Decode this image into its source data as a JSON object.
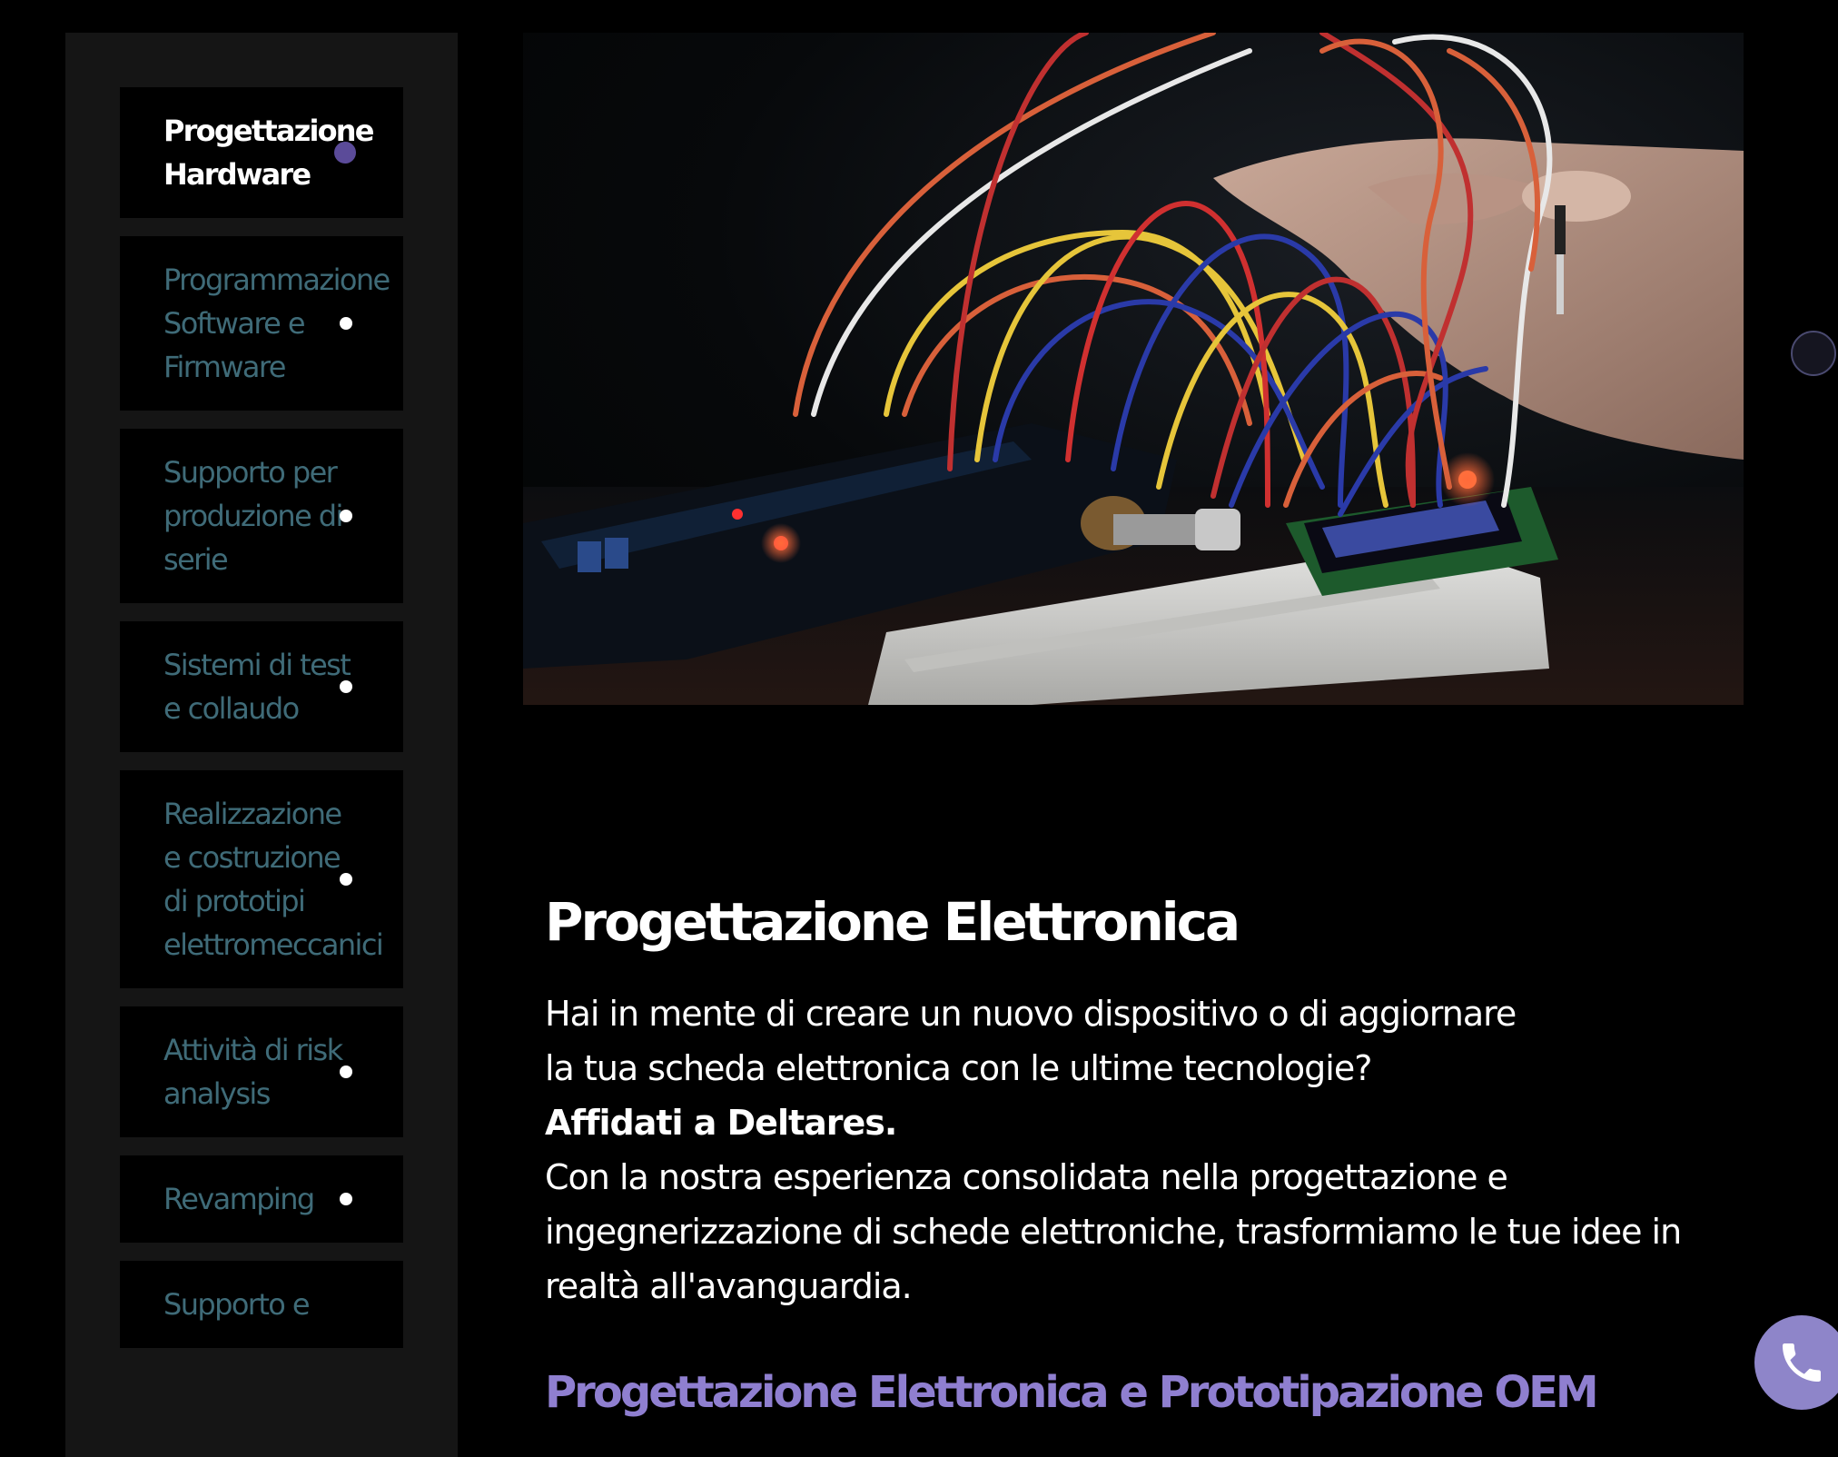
{
  "sidebar": {
    "items": [
      {
        "label": "Progettazione Hardware",
        "active": true
      },
      {
        "label": "Programmazione Software e Firmware",
        "active": false
      },
      {
        "label": "Supporto per produzione di serie",
        "active": false
      },
      {
        "label": "Sistemi di test e collaudo",
        "active": false
      },
      {
        "label": "Realizzazione e costruzione di prototipi elettromeccanici",
        "active": false
      },
      {
        "label": "Attività di risk analysis",
        "active": false
      },
      {
        "label": "Revamping",
        "active": false
      },
      {
        "label": "Supporto e",
        "active": false
      }
    ]
  },
  "main": {
    "title": "Progettazione Elettronica",
    "intro": {
      "line1": "Hai in mente di creare un nuovo dispositivo o di aggiornare",
      "line2": "la tua scheda elettronica con le ultime tecnologie?",
      "strong": "Affidati a Deltares.",
      "line3": "Con la nostra esperienza consolidata nella progettazione e",
      "line4": "ingegnerizzazione di schede elettroniche, trasformiamo le tue idee in",
      "line5": "realtà all'avanguardia."
    },
    "subtitle": "Progettazione Elettronica e Prototipazione OEM"
  },
  "icons": {
    "call": "phone-icon",
    "indicator": "scroll-indicator-icon",
    "bullet": "dot-icon"
  },
  "colors": {
    "background": "#000000",
    "sidebar_bg": "#151515",
    "inactive_text": "#3f6b78",
    "accent": "#8e85c9",
    "active_dot": "#5b4b99",
    "subtitle": "#8f7fd0"
  }
}
